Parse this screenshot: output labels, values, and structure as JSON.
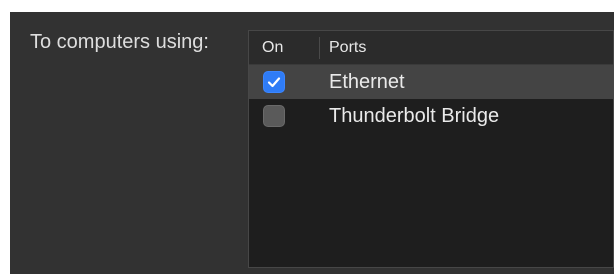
{
  "sharing": {
    "label": "To computers using:",
    "table": {
      "columns": {
        "on": "On",
        "ports": "Ports"
      },
      "rows": [
        {
          "name": "Ethernet",
          "checked": true,
          "selected": true
        },
        {
          "name": "Thunderbolt Bridge",
          "checked": false,
          "selected": false
        }
      ]
    },
    "colors": {
      "checkbox_accent": "#2f7cf6",
      "selected_row": "#444444",
      "panel_bg": "#323232",
      "table_bg": "#1e1e1e"
    },
    "icons": {
      "check": "checkmark-icon"
    }
  }
}
